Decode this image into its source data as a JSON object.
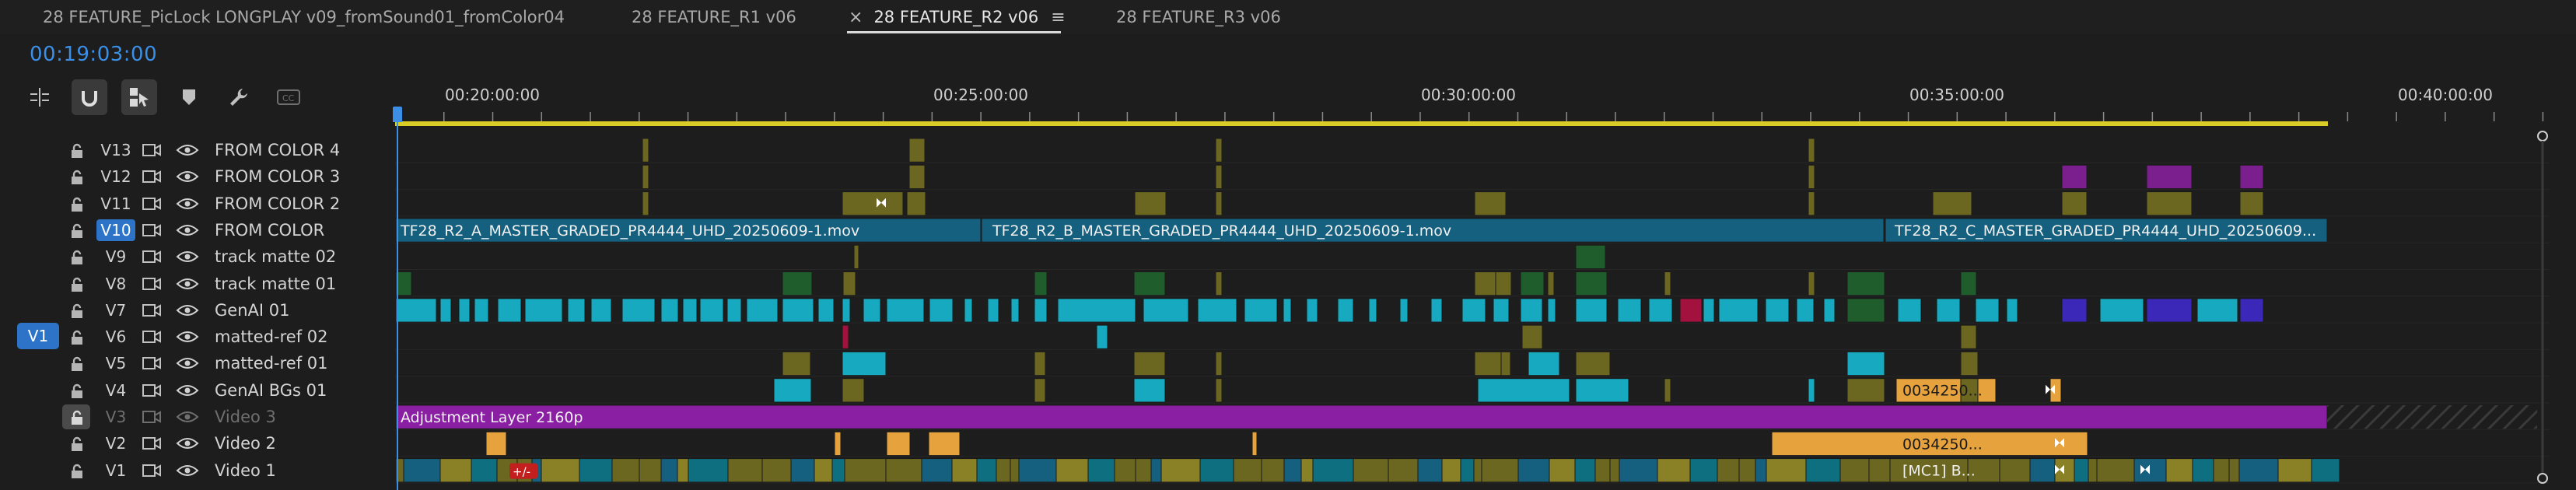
{
  "tabs": [
    {
      "label": "28 FEATURE_PicLock LONGPLAY v09_fromSound01_fromColor04",
      "active": false
    },
    {
      "label": "28 FEATURE_R1 v06",
      "active": false
    },
    {
      "label": "28 FEATURE_R2 v06",
      "active": true,
      "close_glyph": "×",
      "menu_glyph": "≡"
    },
    {
      "label": "28 FEATURE_R3 v06",
      "active": false
    }
  ],
  "timecode": "00:19:03:00",
  "toolbar": {
    "icons": [
      "insert-track-icon",
      "snap-magnet-icon",
      "linked-selection-icon",
      "add-marker-icon",
      "settings-wrench-icon",
      "captions-icon"
    ]
  },
  "ruler": {
    "labels": [
      "00:20:00:00",
      "00:25:00:00",
      "00:30:00:00",
      "00:35:00:00",
      "00:40:00:00"
    ]
  },
  "source_patch": "V1",
  "tracks": [
    {
      "id": "V13",
      "name": "FROM COLOR 4",
      "selected": false,
      "dim": false
    },
    {
      "id": "V12",
      "name": "FROM COLOR 3",
      "selected": false,
      "dim": false
    },
    {
      "id": "V11",
      "name": "FROM COLOR 2",
      "selected": false,
      "dim": false
    },
    {
      "id": "V10",
      "name": "FROM COLOR",
      "selected": true,
      "dim": false
    },
    {
      "id": "V9",
      "name": "track matte 02",
      "selected": false,
      "dim": false
    },
    {
      "id": "V8",
      "name": "track matte 01",
      "selected": false,
      "dim": false
    },
    {
      "id": "V7",
      "name": "GenAI 01",
      "selected": false,
      "dim": false
    },
    {
      "id": "V6",
      "name": "matted-ref 02",
      "selected": false,
      "dim": false
    },
    {
      "id": "V5",
      "name": "matted-ref 01",
      "selected": false,
      "dim": false
    },
    {
      "id": "V4",
      "name": "GenAI BGs 01",
      "selected": false,
      "dim": false
    },
    {
      "id": "V3",
      "name": "Video 3",
      "selected": false,
      "dim": true
    },
    {
      "id": "V2",
      "name": "Video 2",
      "selected": false,
      "dim": false
    },
    {
      "id": "V1",
      "name": "Video 1",
      "selected": false,
      "dim": false
    }
  ],
  "clips": {
    "v10_a": "TF28_R2_A_MASTER_GRADED_PR4444_UHD_20250609-1.mov",
    "v10_b": "TF28_R2_B_MASTER_GRADED_PR4444_UHD_20250609-1.mov",
    "v10_c": "TF28_R2_C_MASTER_GRADED_PR4444_UHD_20250609...",
    "v3_adjust": "Adjustment Layer 2160p",
    "v4_label": "0034250...",
    "v2_label": "0034250...",
    "v1_mc": "[MC1] B...",
    "v1_fx": "+/-"
  },
  "colors": {
    "olive": "#6b6620",
    "olive_bright": "#8a8126",
    "teal": "#16a9bf",
    "teal_dark": "#0e6f80",
    "blue_clip": "#15607e",
    "purple": "#7b1f8f",
    "magenta": "#8a1fa3",
    "orange": "#e6a23c",
    "green": "#1f5e2c",
    "indigo": "#3b27b8",
    "crimson": "#a3123f",
    "playhead": "#3b8fe6",
    "workbar": "#d9cc27"
  }
}
